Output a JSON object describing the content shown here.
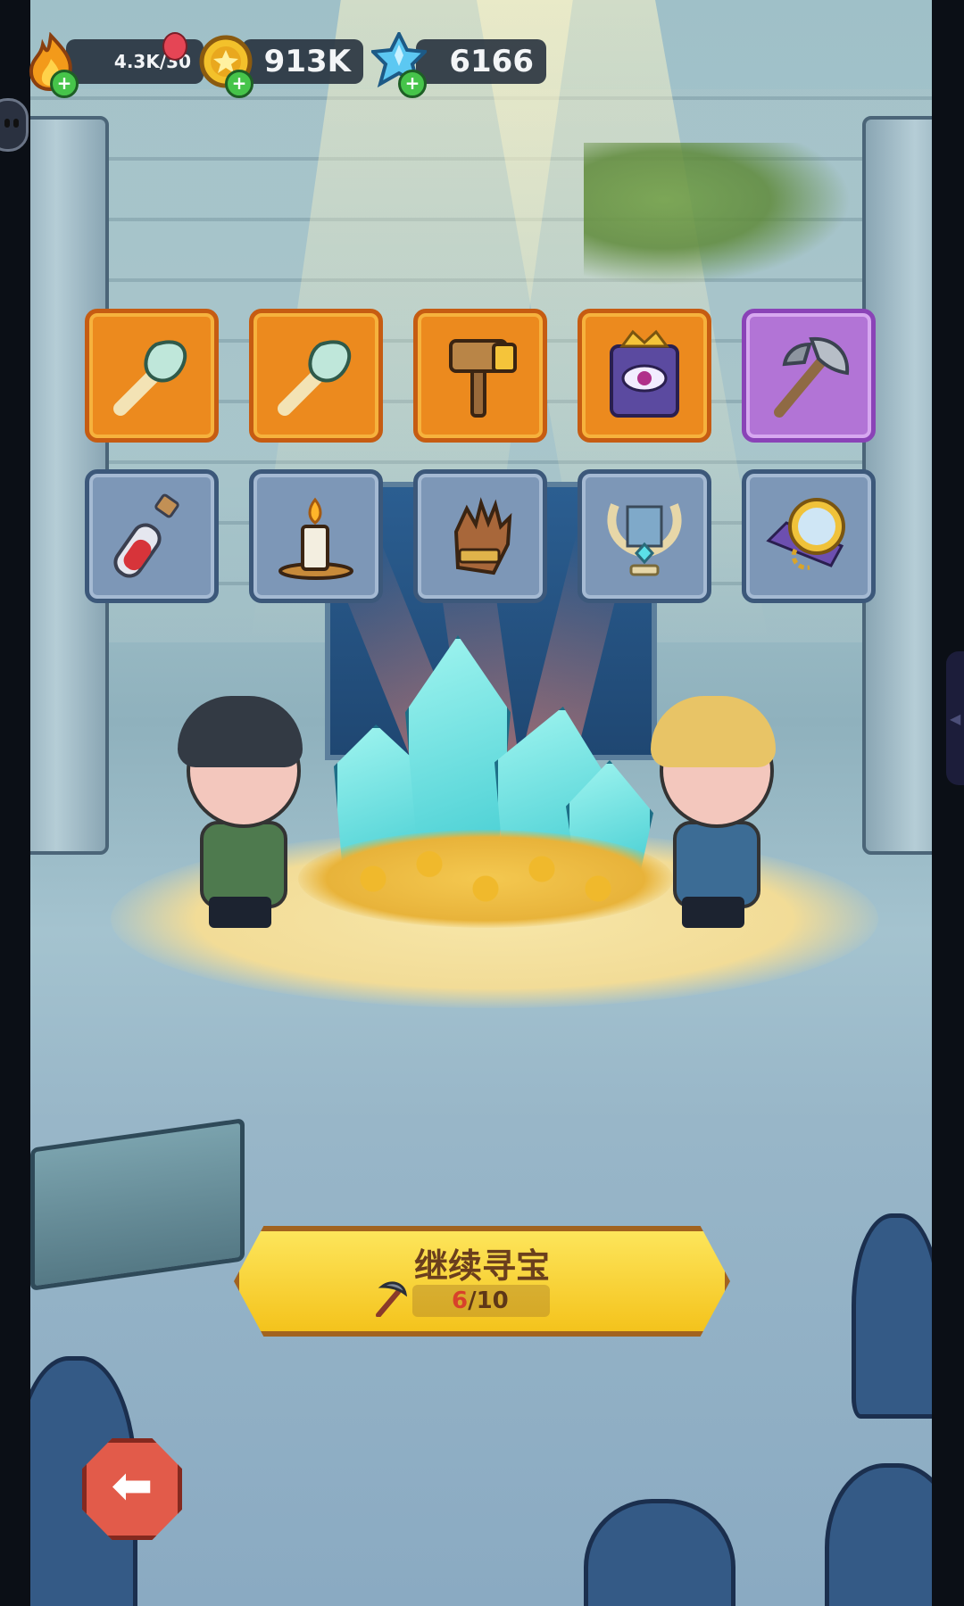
{
  "resources": {
    "energy": {
      "value": "4.3K/30",
      "icon": "fire-icon"
    },
    "gold": {
      "value": "913K",
      "icon": "gold-coin-icon"
    },
    "gems": {
      "value": "6166",
      "icon": "blue-crystal-icon"
    }
  },
  "items_row1": [
    {
      "name": "feather-quill-item",
      "rarity": "orange"
    },
    {
      "name": "feather-quill-item",
      "rarity": "orange"
    },
    {
      "name": "hammer-item",
      "rarity": "orange"
    },
    {
      "name": "eye-tome-item",
      "rarity": "orange"
    },
    {
      "name": "battle-axe-item",
      "rarity": "purple"
    }
  ],
  "items_row2": [
    {
      "name": "potion-vial-item",
      "rarity": "blue"
    },
    {
      "name": "candle-item",
      "rarity": "blue"
    },
    {
      "name": "leather-glove-item",
      "rarity": "blue"
    },
    {
      "name": "golden-lyre-item",
      "rarity": "blue"
    },
    {
      "name": "pocket-mirror-item",
      "rarity": "blue"
    }
  ],
  "continue_button": {
    "label": "继续寻宝",
    "progress_current": "6",
    "progress_total": "/10"
  },
  "colors": {
    "orange_slot": "#ec8a1e",
    "purple_slot": "#b274d6",
    "blue_slot": "#7d97b7",
    "button_yellow": "#f4c31c",
    "back_button_red": "#e25b4a"
  }
}
